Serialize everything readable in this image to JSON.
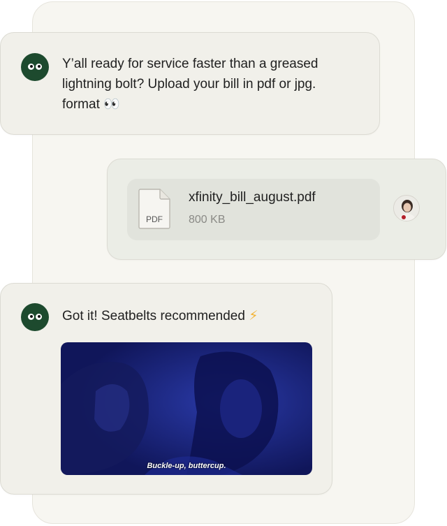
{
  "messages": [
    {
      "sender": "bot",
      "text_line1": "Y’all ready for service faster than a greased",
      "text_line2": "lightning bolt? Upload your bill in pdf or jpg.",
      "text_line3": "format",
      "emoji": "👀"
    },
    {
      "sender": "user",
      "file": {
        "icon_label": "PDF",
        "name": "xfinity_bill_august.pdf",
        "size": "800 KB"
      }
    },
    {
      "sender": "bot",
      "text": "Got it! Seatbelts recommended",
      "emoji": "⚡",
      "gif_caption": "Buckle-up, buttercup."
    }
  ],
  "icons": {
    "bot_avatar": "bot-eyes-icon",
    "file": "pdf-file-icon",
    "user_avatar": "user-photo"
  },
  "colors": {
    "bot_avatar_bg": "#1d4a2e",
    "bubble_bg": "#f1f0ea",
    "panel_bg": "#f7f6f1",
    "lightning": "#f2b233"
  }
}
